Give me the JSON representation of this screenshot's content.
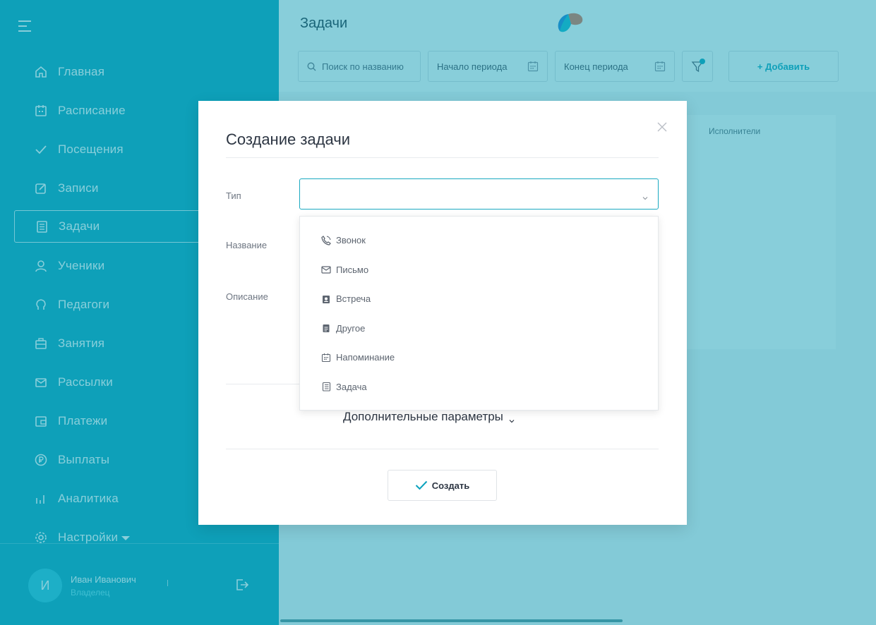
{
  "sidebar": {
    "items": [
      {
        "label": "Главная",
        "icon": "home-icon"
      },
      {
        "label": "Расписание",
        "icon": "calendar-icon"
      },
      {
        "label": "Посещения",
        "icon": "check-icon"
      },
      {
        "label": "Записи",
        "icon": "edit-icon"
      },
      {
        "label": "Задачи",
        "icon": "tasks-icon",
        "active": true
      },
      {
        "label": "Ученики",
        "icon": "user-icon"
      },
      {
        "label": "Педагоги",
        "icon": "teacher-icon"
      },
      {
        "label": "Занятия",
        "icon": "briefcase-icon"
      },
      {
        "label": "Рассылки",
        "icon": "mail-icon"
      },
      {
        "label": "Платежи",
        "icon": "wallet-icon"
      },
      {
        "label": "Выплаты",
        "icon": "ruble-icon"
      },
      {
        "label": "Аналитика",
        "icon": "chart-icon"
      },
      {
        "label": "Настройки",
        "icon": "gear-icon"
      }
    ],
    "user": {
      "initial": "И",
      "name": "Иван Иванович",
      "role": "Владелец"
    }
  },
  "header": {
    "title": "Задачи",
    "search_placeholder": "Поиск по названию",
    "start_period": "Начало периода",
    "end_period": "Конец периода",
    "add_label": "+ Добавить"
  },
  "table": {
    "col_executors": "Исполнители"
  },
  "modal": {
    "title": "Создание задачи",
    "type_label": "Тип",
    "name_label": "Название",
    "description_label": "Описание",
    "type_options": [
      {
        "label": "Звонок",
        "icon": "phone-icon"
      },
      {
        "label": "Письмо",
        "icon": "mail-icon"
      },
      {
        "label": "Встреча",
        "icon": "meeting-icon"
      },
      {
        "label": "Другое",
        "icon": "clipboard-icon"
      },
      {
        "label": "Напоминание",
        "icon": "calendar-icon"
      },
      {
        "label": "Задача",
        "icon": "tasks-icon"
      }
    ],
    "extra_params": "Дополнительные параметры",
    "create_label": "Создать"
  },
  "colors": {
    "accent": "#0aa2bd",
    "overlay": "#129eb6"
  }
}
